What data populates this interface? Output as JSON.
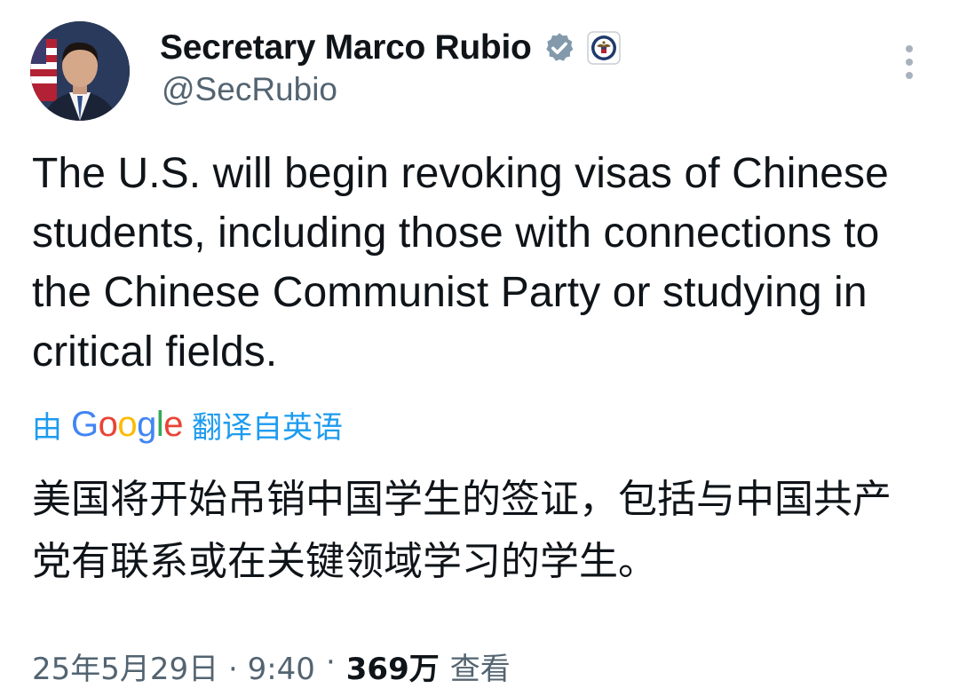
{
  "author": {
    "display_name": "Secretary Marco Rubio",
    "handle": "@SecRubio",
    "verified_icon": "verified-badge-icon",
    "affiliation_icon": "us-state-department-seal-icon"
  },
  "tweet": {
    "text": "The U.S. will begin revoking visas of Chinese students, including those with connections to the Chinese Communist Party or studying in critical fields."
  },
  "translation": {
    "prefix": "由",
    "brand": "Google",
    "suffix": "翻译自英语",
    "text": "美国将开始吊销中国学生的签证，包括与中国共产党有联系或在关键领域学习的学生。"
  },
  "meta": {
    "timestamp": "25年5月29日 · 9:40",
    "views": "369万",
    "views_label": "查看"
  },
  "colors": {
    "link": "#1d9bf0",
    "secondary_text": "#536471",
    "verified": "#829aab"
  }
}
